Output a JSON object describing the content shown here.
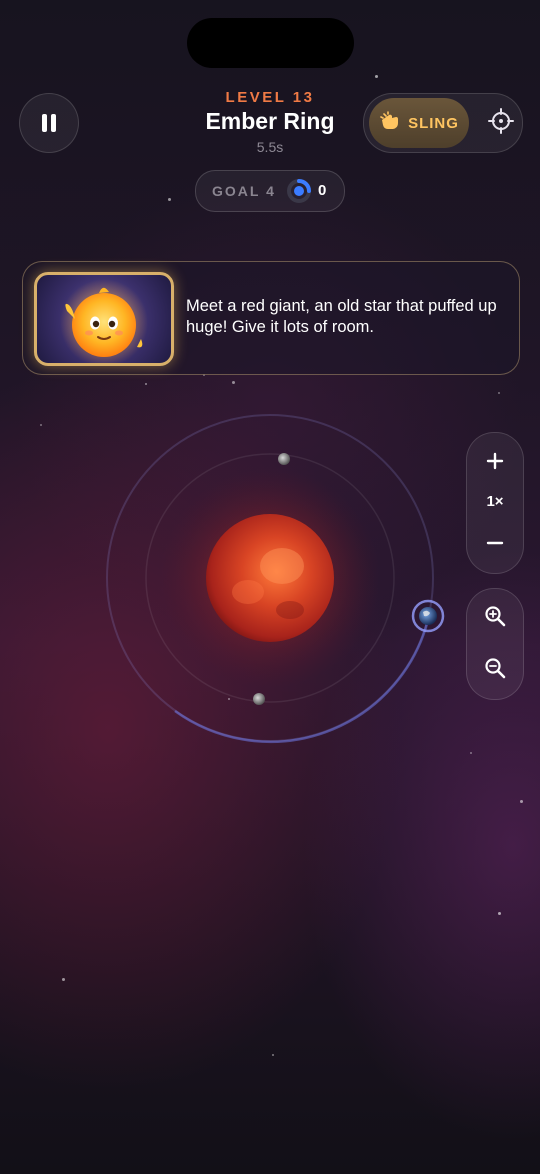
{
  "level": {
    "label": "LEVEL 13",
    "title": "Ember Ring",
    "time": "5.5s"
  },
  "mode": {
    "sling_label": "SLING",
    "active": "sling"
  },
  "goal": {
    "label": "GOAL 4",
    "count": "0",
    "progress_fraction": 0.25
  },
  "dialog": {
    "message": "Meet a red giant, an old star that puffed up huge! Give it lots of room."
  },
  "zoom": {
    "level": "1×"
  },
  "icons": {
    "pause": "pause-icon",
    "sling": "hand-pointer-icon",
    "target": "crosshair-icon",
    "zoom_in": "plus-icon",
    "zoom_out": "minus-icon",
    "magnify_in": "magnify-plus-icon",
    "magnify_out": "magnify-minus-icon"
  },
  "colors": {
    "accent_level": "#f07a45",
    "sling_text": "#ffc561",
    "star_core": "#c93a22",
    "orbit": "#6b6fd0"
  }
}
